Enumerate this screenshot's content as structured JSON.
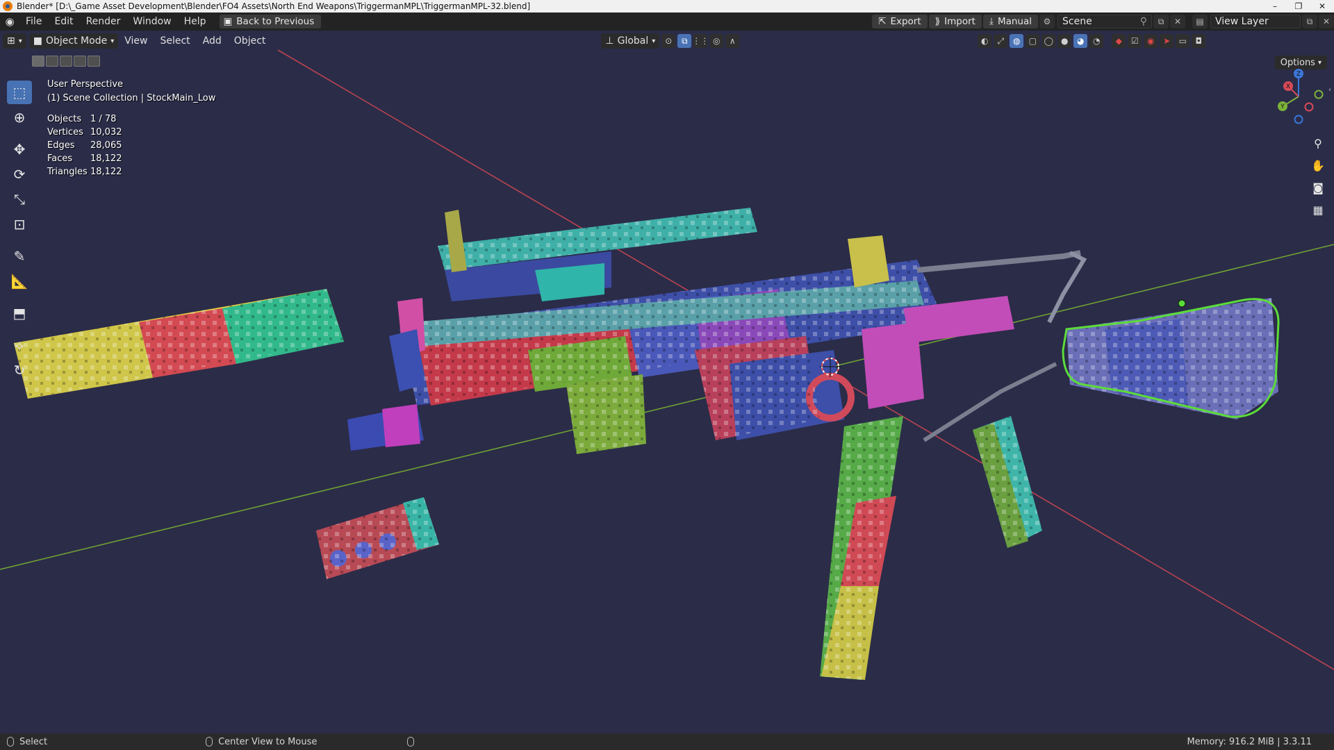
{
  "window": {
    "title": "Blender* [D:\\_Game Asset Development\\Blender\\FO4 Assets\\North End Weapons\\TriggermanMPL\\TriggermanMPL-32.blend]",
    "min": "–",
    "max": "❐",
    "close": "✕"
  },
  "menubar": {
    "items": [
      "File",
      "Edit",
      "Render",
      "Window",
      "Help"
    ],
    "back_button": "Back to Previous",
    "export": "Export",
    "import": "Import",
    "manual": "Manual",
    "scene": "Scene",
    "view_layer": "View Layer"
  },
  "header3d": {
    "mode": "Object Mode",
    "menus": [
      "View",
      "Select",
      "Add",
      "Object"
    ],
    "orientation": "Global",
    "options": "Options"
  },
  "overlay": {
    "view": "User Perspective",
    "collection": "(1) Scene Collection | StockMain_Low"
  },
  "stats": [
    {
      "label": "Objects",
      "value": "1 / 78"
    },
    {
      "label": "Vertices",
      "value": "10,032"
    },
    {
      "label": "Edges",
      "value": "28,065"
    },
    {
      "label": "Faces",
      "value": "18,122"
    },
    {
      "label": "Triangles",
      "value": "18,122"
    }
  ],
  "gizmo": {
    "x": "X",
    "y": "Y",
    "z": "Z"
  },
  "statusbar": {
    "select": "Select",
    "center": "Center View to Mouse",
    "memory": "Memory: 916.2 MiB | 3.3.11"
  },
  "colors": {
    "accent": "#4772b3",
    "viewport": "#2b2c48",
    "x_axis": "#c84a55",
    "y_axis": "#7fae3a",
    "selection": "#5bdc3a"
  },
  "icons": [
    "blender-icon",
    "cursor-icon",
    "move-icon",
    "rotate-icon",
    "scale-icon",
    "transform-icon",
    "annotate-icon",
    "measure-icon",
    "add-cube-icon",
    "zoom-icon",
    "hand-icon",
    "camera-icon",
    "grid-icon"
  ]
}
